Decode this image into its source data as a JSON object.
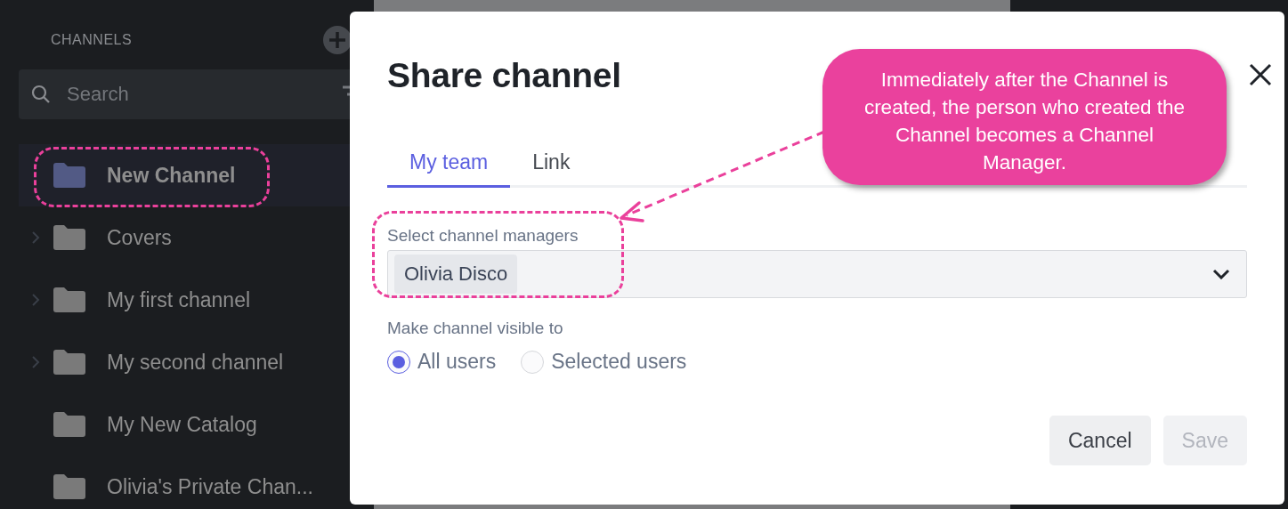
{
  "sidebar": {
    "heading": "CHANNELS",
    "search": {
      "placeholder": "Search"
    },
    "items": [
      {
        "label": "New Channel",
        "selected": true,
        "expandable": false
      },
      {
        "label": "Covers",
        "selected": false,
        "expandable": true
      },
      {
        "label": "My first channel",
        "selected": false,
        "expandable": true
      },
      {
        "label": "My second channel",
        "selected": false,
        "expandable": true
      },
      {
        "label": "My New Catalog",
        "selected": false,
        "expandable": false
      },
      {
        "label": "Olivia's Private Chan...",
        "selected": false,
        "expandable": false
      }
    ]
  },
  "dialog": {
    "title": "Share channel",
    "tabs": [
      {
        "label": "My team",
        "selected": true
      },
      {
        "label": "Link",
        "selected": false
      }
    ],
    "managers_label": "Select channel managers",
    "managers": [
      "Olivia Disco"
    ],
    "visibility_label": "Make channel visible to",
    "visibility_options": [
      {
        "label": "All users",
        "selected": true
      },
      {
        "label": "Selected users",
        "selected": false
      }
    ],
    "buttons": [
      {
        "label": "Cancel",
        "disabled": false
      },
      {
        "label": "Save",
        "disabled": true
      }
    ]
  },
  "callout": {
    "text": "Immediately after the Channel is created, the person who created the Channel becomes a Channel Manager."
  }
}
